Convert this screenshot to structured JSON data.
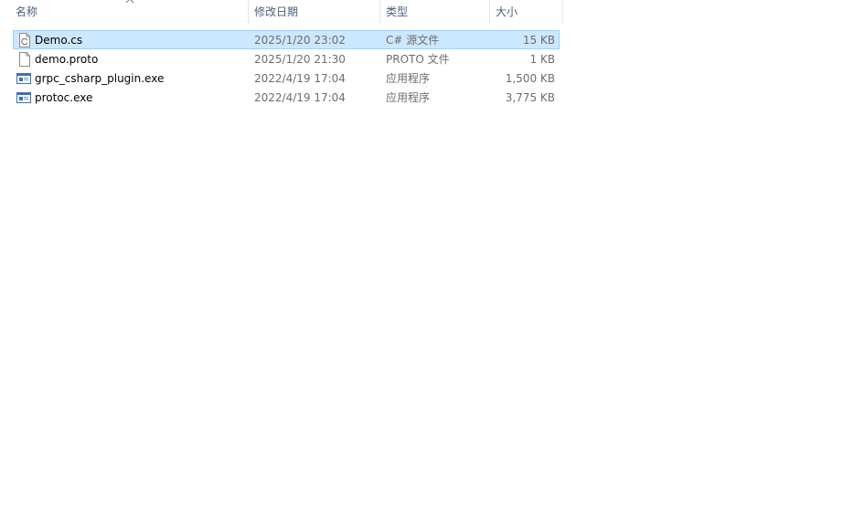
{
  "columns": {
    "name": "名称",
    "date": "修改日期",
    "type": "类型",
    "size": "大小"
  },
  "files": [
    {
      "name": "Demo.cs",
      "date": "2025/1/20 23:02",
      "type": "C# 源文件",
      "size": "15 KB",
      "icon": "csharp-file-icon",
      "selected": true
    },
    {
      "name": "demo.proto",
      "date": "2025/1/20 21:30",
      "type": "PROTO 文件",
      "size": "1 KB",
      "icon": "blank-file-icon",
      "selected": false
    },
    {
      "name": "grpc_csharp_plugin.exe",
      "date": "2022/4/19 17:04",
      "type": "应用程序",
      "size": "1,500 KB",
      "icon": "application-icon",
      "selected": false
    },
    {
      "name": "protoc.exe",
      "date": "2022/4/19 17:04",
      "type": "应用程序",
      "size": "3,775 KB",
      "icon": "application-icon",
      "selected": false
    }
  ],
  "colors": {
    "selection_bg": "#cce8ff",
    "selection_border": "#99d1ff",
    "header_text": "#4c607a"
  }
}
